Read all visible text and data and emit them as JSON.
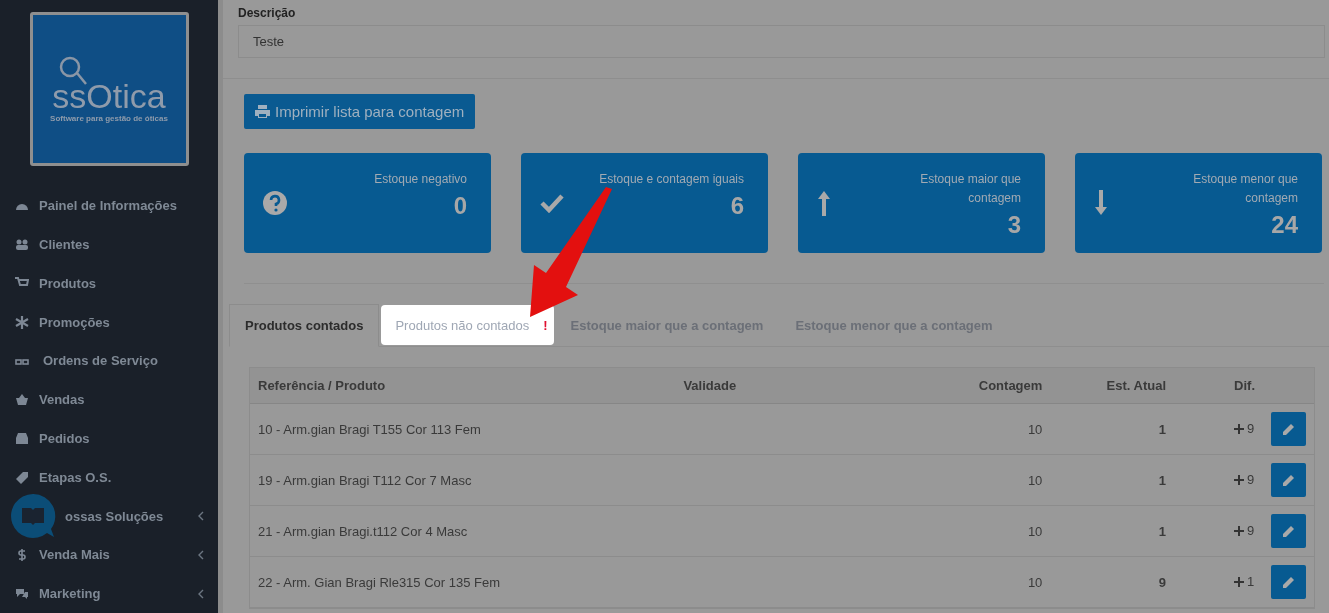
{
  "sidebar": {
    "logo": {
      "name": "ssOtica",
      "tagline": "Software para gestão de óticas"
    },
    "items": [
      {
        "label": "Painel de Informações",
        "submenu": false
      },
      {
        "label": "Clientes",
        "submenu": false
      },
      {
        "label": "Produtos",
        "submenu": false
      },
      {
        "label": "Promoções",
        "submenu": false
      },
      {
        "label": "Ordens de Serviço",
        "submenu": false
      },
      {
        "label": "Vendas",
        "submenu": false
      },
      {
        "label": "Pedidos",
        "submenu": false
      },
      {
        "label": "Etapas O.S.",
        "submenu": false
      },
      {
        "label": "ossas Soluções",
        "submenu": true
      },
      {
        "label": "Venda Mais",
        "submenu": true
      },
      {
        "label": "Marketing",
        "submenu": true
      }
    ]
  },
  "form": {
    "label": "Descrição",
    "value": "Teste"
  },
  "print_button": "Imprimir lista para contagem",
  "cards": [
    {
      "kind": "negative",
      "label": "Estoque negativo",
      "value": "0"
    },
    {
      "kind": "equal",
      "label": "Estoque e contagem iguais",
      "value": "6"
    },
    {
      "kind": "greater",
      "label": "Estoque maior que contagem",
      "value": "3"
    },
    {
      "kind": "lower",
      "label": "Estoque menor que contagem",
      "value": "24"
    }
  ],
  "tabs": [
    {
      "label": "Produtos contados",
      "selected": true,
      "highlighted": false,
      "alert": false
    },
    {
      "label": "Produtos não contados",
      "selected": false,
      "highlighted": true,
      "alert": true
    },
    {
      "label": "Estoque maior que a contagem",
      "selected": false,
      "highlighted": false,
      "alert": false
    },
    {
      "label": "Estoque menor que a contagem",
      "selected": false,
      "highlighted": false,
      "alert": false
    }
  ],
  "alert_mark": "!",
  "table": {
    "columns": [
      "Referência / Produto",
      "Validade",
      "Contagem",
      "Est. Atual",
      "Dif."
    ],
    "rows": [
      {
        "product": "10 - Arm.gian Bragi T155 Cor 113 Fem",
        "count": "10",
        "stock": "1",
        "diff": "9"
      },
      {
        "product": "19 - Arm.gian Bragi T112 Cor 7 Masc",
        "count": "10",
        "stock": "1",
        "diff": "9"
      },
      {
        "product": "21 - Arm.gian Bragi.t112 Cor 4 Masc",
        "count": "10",
        "stock": "1",
        "diff": "9"
      },
      {
        "product": "22 - Arm. Gian Bragi Rle315 Cor 135 Fem",
        "count": "10",
        "stock": "9",
        "diff": "1"
      }
    ]
  }
}
